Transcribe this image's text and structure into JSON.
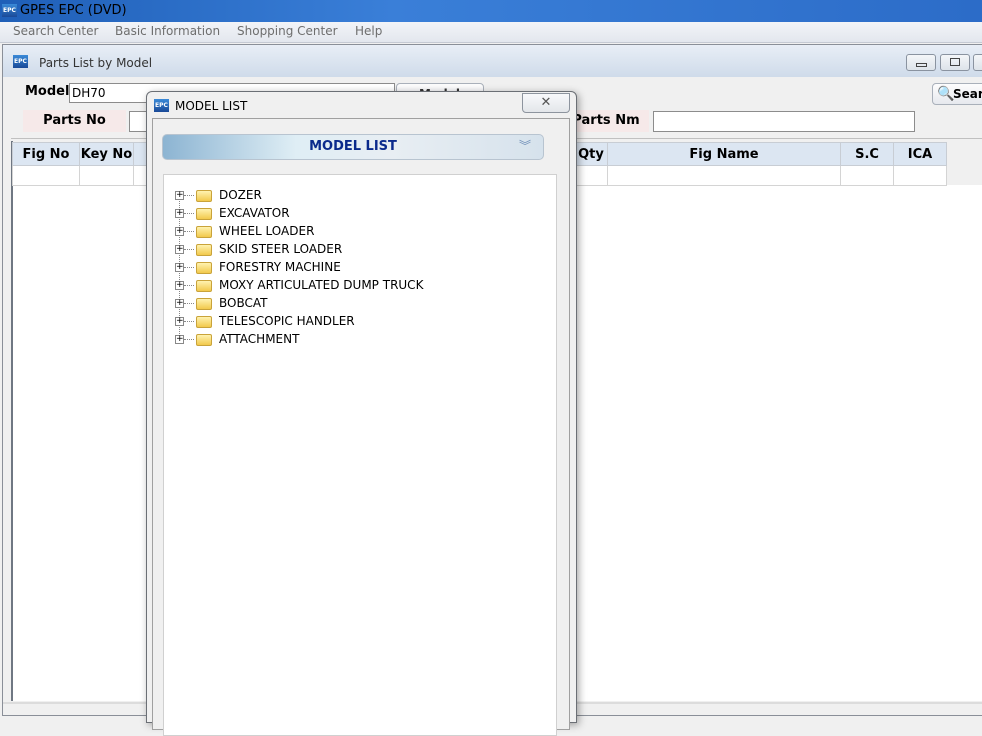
{
  "app": {
    "title": "GPES EPC (DVD)",
    "icon": "epc-logo"
  },
  "menu": [
    "Search Center",
    "Basic Information",
    "Shopping Center",
    "Help"
  ],
  "child": {
    "title": "Parts List by Model",
    "model_label": "Model",
    "model_value": "DH70",
    "model_list_button": "Model List",
    "parts_no_label": "Parts No",
    "parts_no_value": "",
    "parts_nm_label": "Parts Nm",
    "parts_nm_value": "",
    "search_button": "Search"
  },
  "table": {
    "columns": [
      "Fig No",
      "Key No",
      "",
      "Qty",
      "Fig Name",
      "S.C",
      "ICA"
    ]
  },
  "dialog": {
    "title": "MODEL LIST",
    "header": "MODEL LIST",
    "close": "✕",
    "tree": [
      "DOZER",
      "EXCAVATOR",
      "WHEEL LOADER",
      "SKID STEER LOADER",
      "FORESTRY MACHINE",
      "MOXY ARTICULATED DUMP TRUCK",
      "BOBCAT",
      "TELESCOPIC HANDLER",
      "ATTACHMENT"
    ]
  }
}
